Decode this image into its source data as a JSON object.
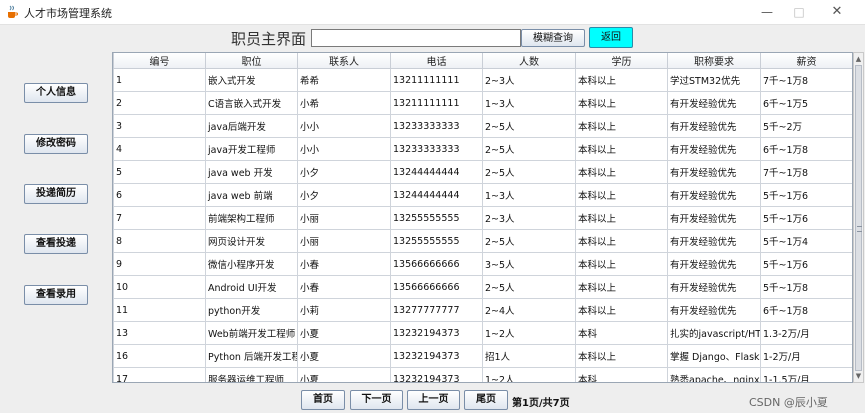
{
  "window": {
    "title": "人才市场管理系统",
    "min": "—",
    "max": "□",
    "close": "✕"
  },
  "header": {
    "heading": "职员主界面",
    "search_value": "",
    "search_button": "模糊查询",
    "back_button": "返回"
  },
  "sidebar": {
    "items": [
      {
        "label": "个人信息"
      },
      {
        "label": "修改密码"
      },
      {
        "label": "投递简历"
      },
      {
        "label": "查看投递"
      },
      {
        "label": "查看录用"
      }
    ]
  },
  "table": {
    "columns": [
      "编号",
      "职位",
      "联系人",
      "电话",
      "人数",
      "学历",
      "职称要求",
      "薪资"
    ],
    "rows": [
      [
        "1",
        "嵌入式开发",
        "希希",
        "13211111111",
        "2~3人",
        "本科以上",
        "学过STM32优先",
        "7千~1万8"
      ],
      [
        "2",
        "C语言嵌入式开发",
        "小希",
        "13211111111",
        "1~3人",
        "本科以上",
        "有开发经验优先",
        "6千~1万5"
      ],
      [
        "3",
        "java后端开发",
        "小小",
        "13233333333",
        "2~5人",
        "本科以上",
        "有开发经验优先",
        "5千~2万"
      ],
      [
        "4",
        "java开发工程师",
        "小小",
        "13233333333",
        "2~5人",
        "本科以上",
        "有开发经验优先",
        "6千~1万8"
      ],
      [
        "5",
        "java web 开发",
        "小夕",
        "13244444444",
        "2~5人",
        "本科以上",
        "有开发经验优先",
        "7千~1万8"
      ],
      [
        "6",
        "java web 前端",
        "小夕",
        "13244444444",
        "1~3人",
        "本科以上",
        "有开发经验优先",
        "5千~1万6"
      ],
      [
        "7",
        "前端架构工程师",
        "小丽",
        "13255555555",
        "2~3人",
        "本科以上",
        "有开发经验优先",
        "5千~1万6"
      ],
      [
        "8",
        "网页设计开发",
        "小丽",
        "13255555555",
        "2~5人",
        "本科以上",
        "有开发经验优先",
        "5千~1万4"
      ],
      [
        "9",
        "微信小程序开发",
        "小春",
        "13566666666",
        "3~5人",
        "本科以上",
        "有开发经验优先",
        "5千~1万6"
      ],
      [
        "10",
        "Android UI开发",
        "小春",
        "13566666666",
        "2~5人",
        "本科以上",
        "有开发经验优先",
        "5千~1万8"
      ],
      [
        "11",
        "python开发",
        "小莉",
        "13277777777",
        "2~4人",
        "本科以上",
        "有开发经验优先",
        "6千~1万8"
      ],
      [
        "13",
        "Web前端开发工程师",
        "小夏",
        "13232194373",
        "1~2人",
        "本科",
        "扎实的javascript/HT...",
        "1.3-2万/月"
      ],
      [
        "16",
        "Python 后端开发工程...",
        "小夏",
        "13232194373",
        "招1人",
        "本科以上",
        "掌握 Django、Flask...",
        "1-2万/月"
      ],
      [
        "17",
        "服务器运维工程师",
        "小夏",
        "13232194373",
        "1~2人",
        "本科",
        "熟悉apache、nginx...",
        "1-1.5万/月"
      ]
    ]
  },
  "pager": {
    "first": "首页",
    "next": "下一页",
    "prev": "上一页",
    "last": "尾页",
    "info": "第1页/共7页"
  },
  "watermark": "CSDN @辰小夏",
  "colors": {
    "back_button_bg": "#00ffff",
    "window_bg": "#eeeeee"
  }
}
